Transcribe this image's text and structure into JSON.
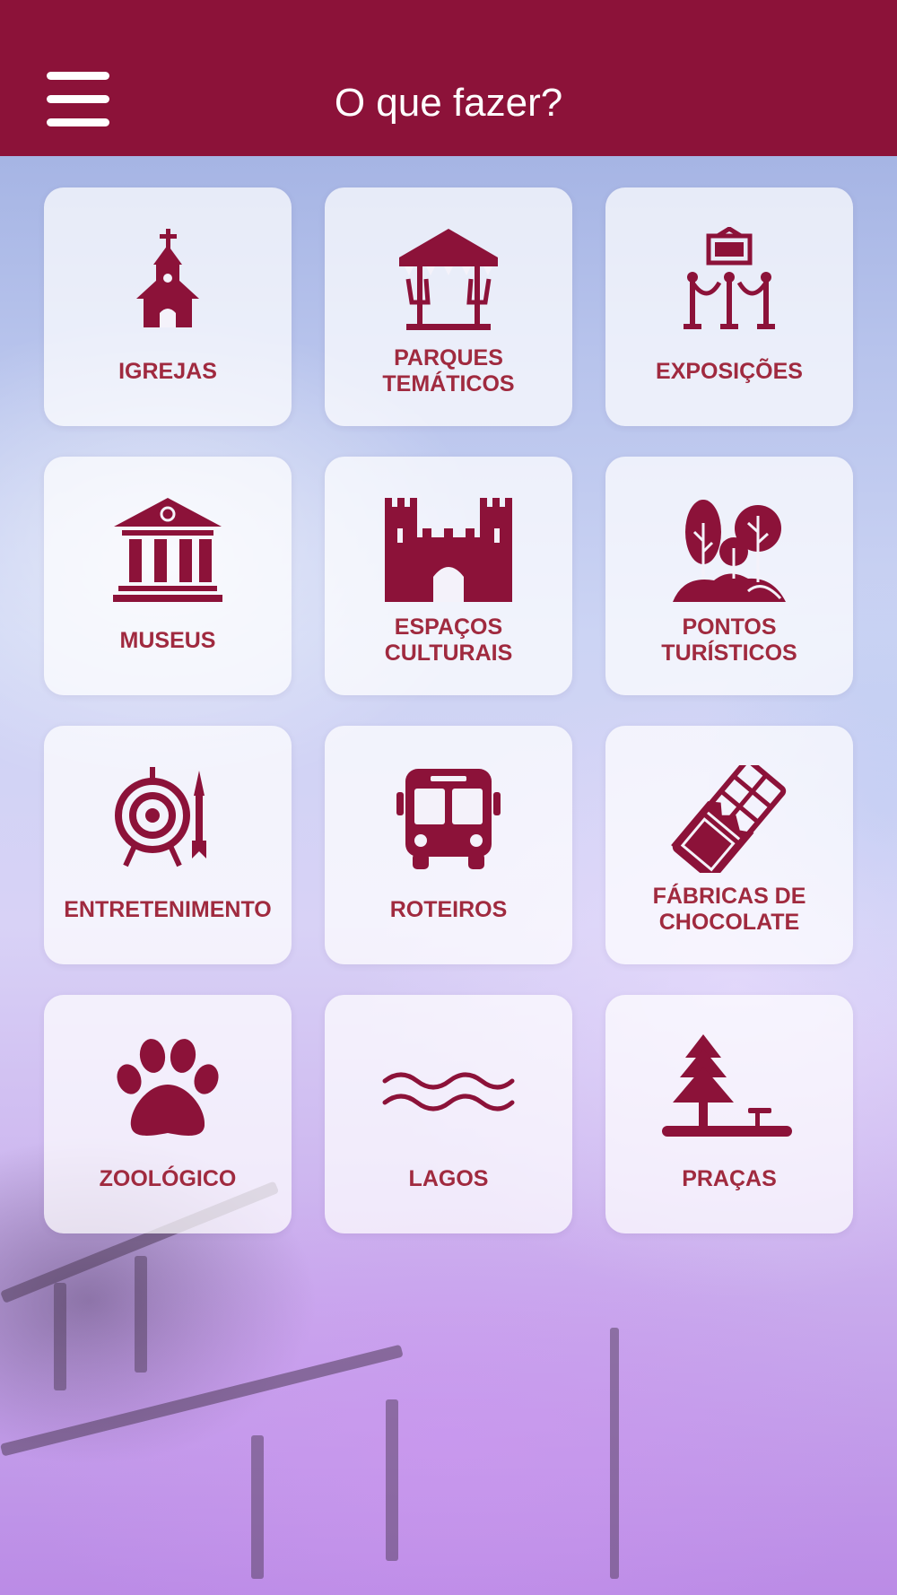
{
  "header": {
    "title": "O que fazer?",
    "menu_icon": "hamburger-menu-icon"
  },
  "colors": {
    "brand": "#8c1239",
    "label": "#a02a3f",
    "tile_bg": "rgba(255,255,255,0.72)"
  },
  "categories": [
    {
      "label": "IGREJAS",
      "icon": "church-icon"
    },
    {
      "label": "PARQUES\nTEMÁTICOS",
      "icon": "carousel-icon"
    },
    {
      "label": "EXPOSIÇÕES",
      "icon": "exhibition-rope-icon"
    },
    {
      "label": "MUSEUS",
      "icon": "museum-icon"
    },
    {
      "label": "ESPAÇOS\nCULTURAIS",
      "icon": "castle-icon"
    },
    {
      "label": "PONTOS\nTURÍSTICOS",
      "icon": "trees-icon"
    },
    {
      "label": "ENTRETENIMENTO",
      "icon": "target-dart-icon"
    },
    {
      "label": "ROTEIROS",
      "icon": "bus-icon"
    },
    {
      "label": "FÁBRICAS DE\nCHOCOLATE",
      "icon": "chocolate-bar-icon"
    },
    {
      "label": "ZOOLÓGICO",
      "icon": "paw-icon"
    },
    {
      "label": "LAGOS",
      "icon": "waves-icon"
    },
    {
      "label": "PRAÇAS",
      "icon": "pine-tree-bench-icon"
    }
  ]
}
